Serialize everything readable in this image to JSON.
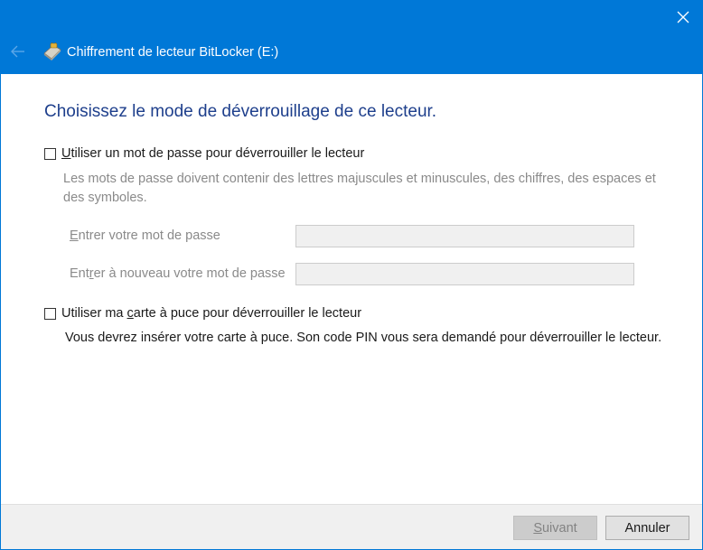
{
  "window": {
    "title": "Chiffrement de lecteur BitLocker (E:)",
    "accent_color": "#0078d7"
  },
  "icons": {
    "close": "close-icon",
    "back": "back-arrow-icon",
    "app": "bitlocker-drive-icon"
  },
  "heading": "Choisissez le mode de déverrouillage de ce lecteur.",
  "password_option": {
    "label_first_letter": "U",
    "label_rest": "tiliser un mot de passe pour déverrouiller le lecteur",
    "checked": false,
    "hint": "Les mots de passe doivent contenir des lettres majuscules et minuscules, des chiffres, des espaces et des symboles.",
    "enter_label_first": "E",
    "enter_label_rest": "ntrer votre mot de passe",
    "enter_value": "",
    "reenter_label_a": "Ent",
    "reenter_label_key": "r",
    "reenter_label_b": "er à nouveau votre mot de passe",
    "reenter_value": ""
  },
  "smartcard_option": {
    "label_a": "Utiliser ma ",
    "label_key": "c",
    "label_b": "arte à puce pour déverrouiller le lecteur",
    "checked": false,
    "info": "Vous devrez insérer votre carte à puce. Son code PIN vous sera demandé pour déverrouiller le lecteur."
  },
  "buttons": {
    "next_key": "S",
    "next_rest": "uivant",
    "next_enabled": false,
    "cancel": "Annuler"
  }
}
